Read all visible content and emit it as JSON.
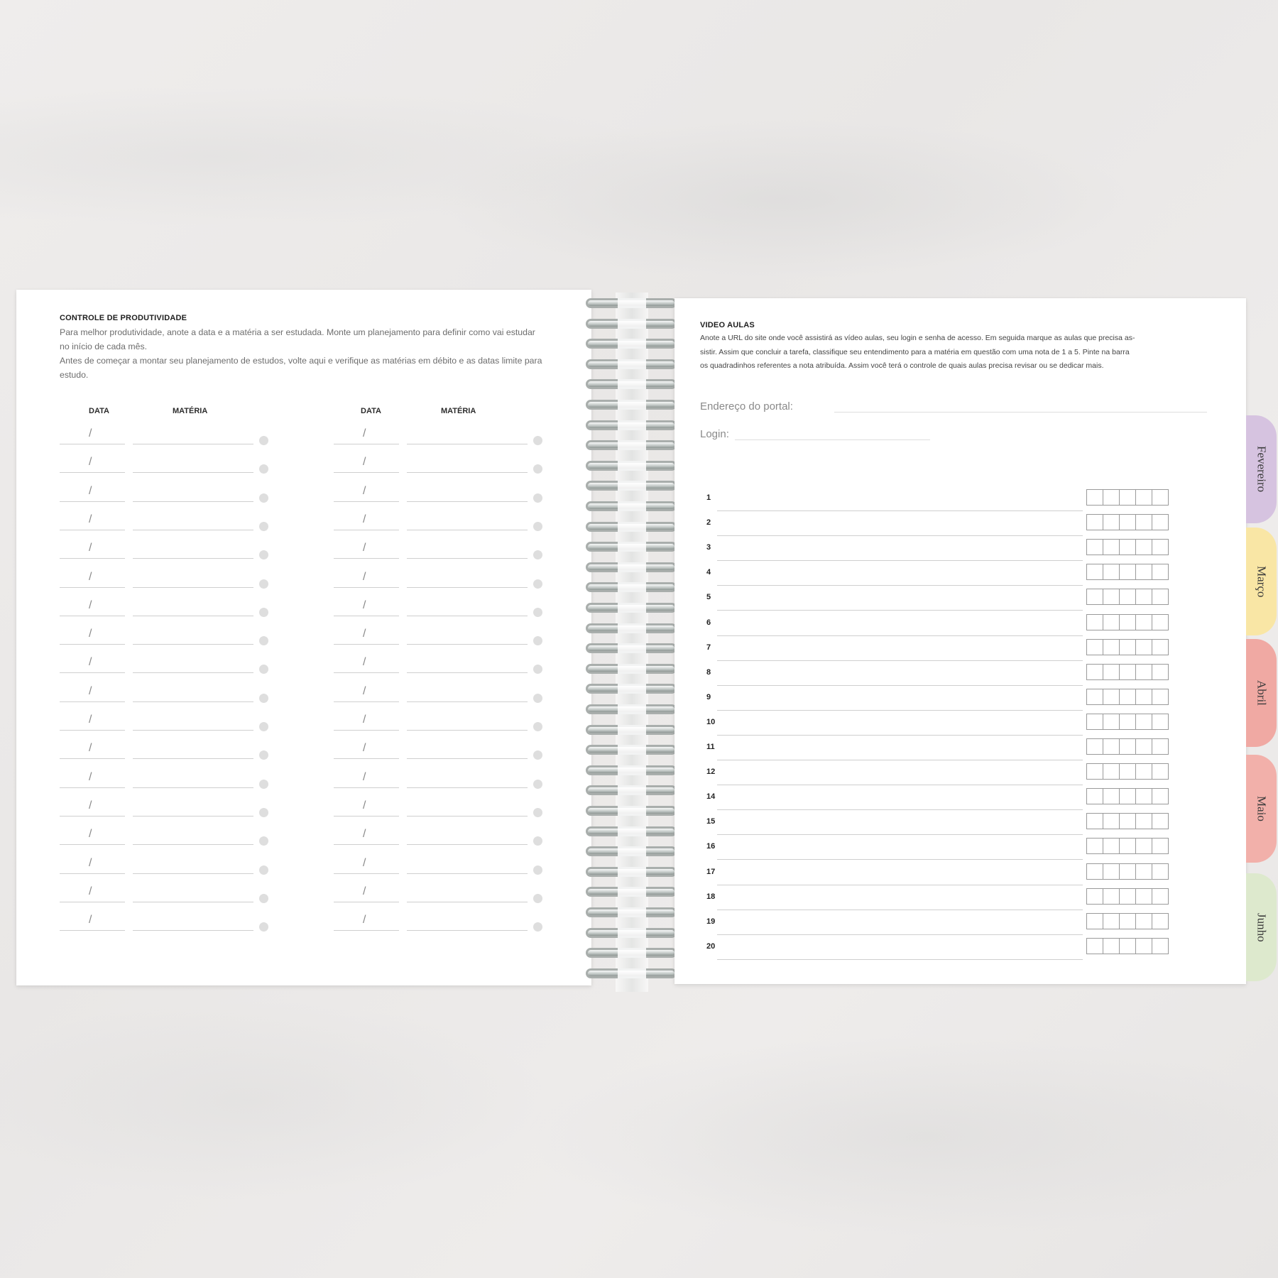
{
  "left_page": {
    "title": "CONTROLE DE PRODUTIVIDADE",
    "paragraph_lines": [
      "Para melhor produtividade, anote a data e a matéria a ser estudada. Monte um planejamento para definir como vai estudar",
      "no início de cada mês.",
      "Antes de começar a montar seu planejamento de estudos, volte aqui e verifique as matérias em débito e as datas limite para",
      "estudo."
    ],
    "column_headers": {
      "date": "DATA",
      "subject": "MATÉRIA"
    },
    "date_separator": "/",
    "rows_per_column": 18
  },
  "right_page": {
    "title": "VIDEO AULAS",
    "paragraph_lines": [
      "Anote a URL do site onde você assistirá as vídeo aulas, seu login e senha de acesso. Em seguida marque as aulas que precisa as-",
      "sistir. Assim que concluir a tarefa, classifique seu entendimento para a matéria em questão com uma nota de 1 a 5. Pinte na barra",
      "os quadradinhos referentes a nota atribuída. Assim você terá o controle de quais aulas precisa revisar ou se dedicar mais."
    ],
    "fields": {
      "portal_label": "Endereço do portal:",
      "login_label": "Login:"
    },
    "lesson_numbers": [
      "1",
      "2",
      "3",
      "4",
      "5",
      "6",
      "7",
      "8",
      "9",
      "10",
      "11",
      "12",
      "14",
      "15",
      "16",
      "17",
      "18",
      "19",
      "20"
    ],
    "boxes_per_row": 5
  },
  "tabs": [
    {
      "label": "Fevereiro",
      "color": "#d6c3e0"
    },
    {
      "label": "Março",
      "color": "#f9e6a5"
    },
    {
      "label": "Abril",
      "color": "#f0a9a3"
    },
    {
      "label": "Maio",
      "color": "#f2b0aa"
    },
    {
      "label": "Junho",
      "color": "#dde9cd"
    }
  ],
  "spiral_rings": 34
}
